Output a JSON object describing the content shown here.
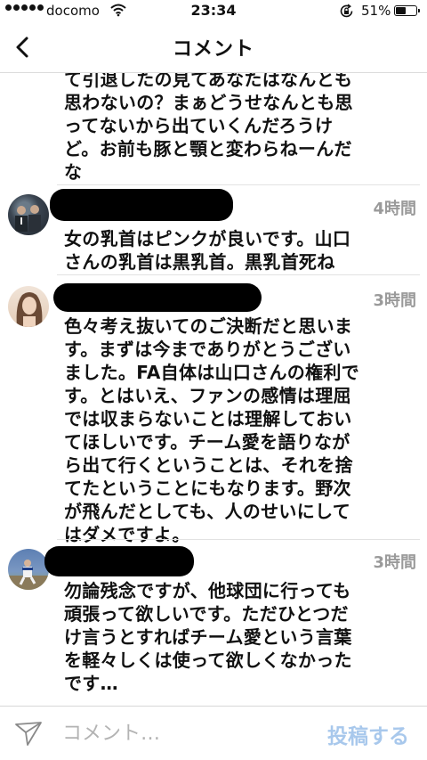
{
  "status_bar": {
    "carrier": "docomo",
    "time": "23:34",
    "battery_text": "51%",
    "battery_level": 0.51
  },
  "nav": {
    "title": "コメント"
  },
  "comments": [
    {
      "text": "て引退したの見てあなたはなんとも\n思わないの？まぁどうせなんとも思\nってないから出ていくんだろうけ\nど。お前も豚と顎と変わらねーんだ\nな"
    },
    {
      "time": "4時間",
      "text": "女の乳首はピンクが良いです。山口\nさんの乳首は黒乳首。黒乳首死ね"
    },
    {
      "time": "3時間",
      "text": "色々考え抜いてのご決断だと思いま\nす。まずは今までありがとうござい\nました。FA自体は山口さんの権利で\nす。とはいえ、ファンの感情は理屈\nでは収まらないことは理解しておい\nてほしいです。チーム愛を語りなが\nら出て行くということは、それを捨\nてたということにもなります。野次\nが飛んだとしても、人のせいにして\nはダメですよ。"
    },
    {
      "time": "3時間",
      "text": "勿論残念ですが、他球団に行っても\n頑張って欲しいです。ただひとつだ\nけ言うとすればチーム愛という言葉\nを軽々しくは使って欲しくなかった\nです…"
    }
  ],
  "input_bar": {
    "placeholder": "コメント…",
    "post_label": "投稿する",
    "post_color": "#a8c8ec"
  },
  "icons": {
    "back": "chevron-left-icon",
    "send": "paper-plane-icon",
    "wifi": "wifi-icon",
    "lock": "rotation-lock-icon",
    "battery": "battery-icon"
  }
}
